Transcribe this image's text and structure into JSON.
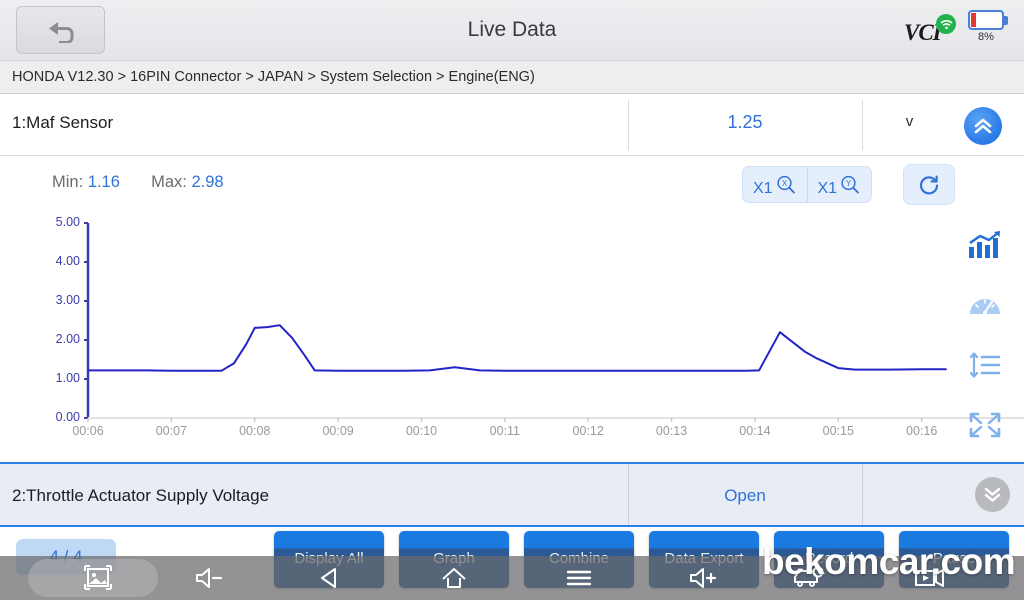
{
  "titlebar": {
    "back_icon": "back-arrow-icon",
    "title": "Live Data",
    "vci_label": "VCI",
    "wifi_icon": "wifi-icon",
    "battery_icon": "battery-icon",
    "battery_percent": "8%"
  },
  "breadcrumb": {
    "text": "HONDA V12.30 > 16PIN Connector  > JAPAN  > System Selection  > Engine(ENG)"
  },
  "row1": {
    "name": "1:Maf Sensor",
    "value": "1.25",
    "unit": "v",
    "collapse_icon": "chevron-double-up-icon"
  },
  "stats": {
    "min_label": "Min:",
    "min_value": "1.16",
    "max_label": "Max:",
    "max_value": "2.98"
  },
  "zoom_controls": {
    "x_factor": "X1",
    "x_icon": "magnifier-x-icon",
    "y_factor": "X1",
    "y_icon": "magnifier-y-icon",
    "refresh_icon": "refresh-icon"
  },
  "rail": [
    {
      "icon": "trend-chart-icon",
      "active": true
    },
    {
      "icon": "gauge-icon",
      "active": false
    },
    {
      "icon": "scale-list-icon",
      "active": false
    },
    {
      "icon": "fullscreen-icon",
      "active": false
    }
  ],
  "row2": {
    "name": "2:Throttle Actuator Supply Voltage",
    "value": "Open",
    "collapse_icon": "chevron-double-down-icon"
  },
  "bottom_buttons": [
    {
      "label": "Display All"
    },
    {
      "label": "Graph"
    },
    {
      "label": "Combine"
    },
    {
      "label": "Data Export"
    },
    {
      "label": "Record"
    },
    {
      "label": "Pause"
    }
  ],
  "page_indicator": "4 / 4",
  "navbar": {
    "screenshot_icon": "screenshot-icon",
    "volume_down_icon": "volume-down-icon",
    "back_icon": "nav-back-triangle-icon",
    "home_icon": "nav-home-icon",
    "menu_icon": "nav-menu-icon",
    "volume_up_icon": "volume-up-icon",
    "car_icon": "car-icon",
    "screenrecord_icon": "screen-record-icon"
  },
  "watermark": "bekomcar.com",
  "colors": {
    "accent_blue": "#2f72d8",
    "line_blue": "#2323c8",
    "axis_label_blue": "#3b3ea8",
    "tick_gray": "#9a9a9d"
  },
  "chart_data": {
    "type": "line",
    "title": "",
    "xlabel": "",
    "ylabel": "",
    "ylim": [
      0.0,
      5.0
    ],
    "yticks": [
      "0.00",
      "1.00",
      "2.00",
      "3.00",
      "4.00",
      "5.00"
    ],
    "xticks": [
      "00:06",
      "00:07",
      "00:08",
      "00:09",
      "00:10",
      "00:11",
      "00:12",
      "00:13",
      "00:14",
      "00:15",
      "00:16"
    ],
    "grid": false,
    "legend": null,
    "series": [
      {
        "name": "1:Maf Sensor",
        "unit": "v",
        "color": "#2323c8",
        "points": [
          [
            6.0,
            1.22
          ],
          [
            6.3,
            1.22
          ],
          [
            6.7,
            1.22
          ],
          [
            7.0,
            1.21
          ],
          [
            7.3,
            1.21
          ],
          [
            7.6,
            1.21
          ],
          [
            7.75,
            1.4
          ],
          [
            7.9,
            1.9
          ],
          [
            8.0,
            2.31
          ],
          [
            8.15,
            2.33
          ],
          [
            8.3,
            2.38
          ],
          [
            8.45,
            2.05
          ],
          [
            8.6,
            1.6
          ],
          [
            8.72,
            1.22
          ],
          [
            9.0,
            1.21
          ],
          [
            9.4,
            1.21
          ],
          [
            9.8,
            1.21
          ],
          [
            10.1,
            1.22
          ],
          [
            10.4,
            1.3
          ],
          [
            10.7,
            1.22
          ],
          [
            11.0,
            1.21
          ],
          [
            11.5,
            1.21
          ],
          [
            12.0,
            1.21
          ],
          [
            12.5,
            1.21
          ],
          [
            13.0,
            1.21
          ],
          [
            13.5,
            1.21
          ],
          [
            13.9,
            1.21
          ],
          [
            14.05,
            1.22
          ],
          [
            14.3,
            2.2
          ],
          [
            14.6,
            1.7
          ],
          [
            14.75,
            1.52
          ],
          [
            15.0,
            1.28
          ],
          [
            15.2,
            1.24
          ],
          [
            15.6,
            1.24
          ],
          [
            16.0,
            1.25
          ],
          [
            16.3,
            1.25
          ]
        ]
      }
    ]
  }
}
